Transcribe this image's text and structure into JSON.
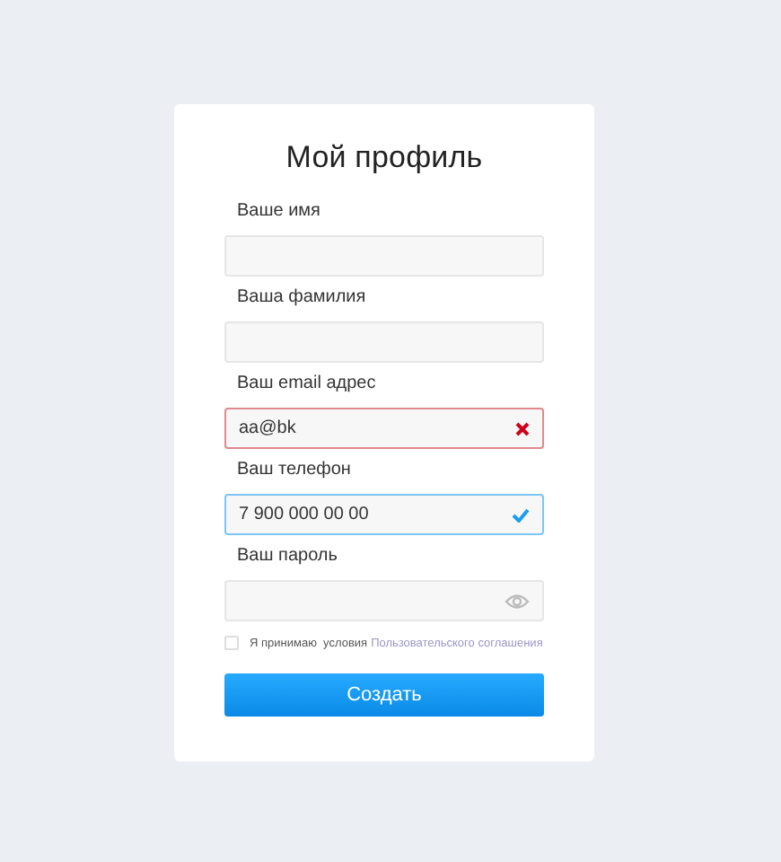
{
  "form": {
    "title": "Мой профиль",
    "fields": [
      {
        "label": "Ваше имя",
        "kind": "text",
        "error": false,
        "valid": false
      },
      {
        "label": "Ваша фамилия",
        "kind": "text",
        "error": false,
        "valid": false
      },
      {
        "label": "Ваш email адрес",
        "kind": "text",
        "error": true,
        "valid": false,
        "value": "aa@bk"
      },
      {
        "label": "Ваш телефон",
        "kind": "text",
        "error": false,
        "valid": true,
        "value": "7 900 000 00 00"
      },
      {
        "label": "Ваш пароль",
        "kind": "password",
        "error": false,
        "valid": false
      }
    ],
    "agreement": {
      "checked": false,
      "text": "Я принимаю  условия",
      "link": "Пользовательского соглашения"
    },
    "submit": "Создать"
  }
}
